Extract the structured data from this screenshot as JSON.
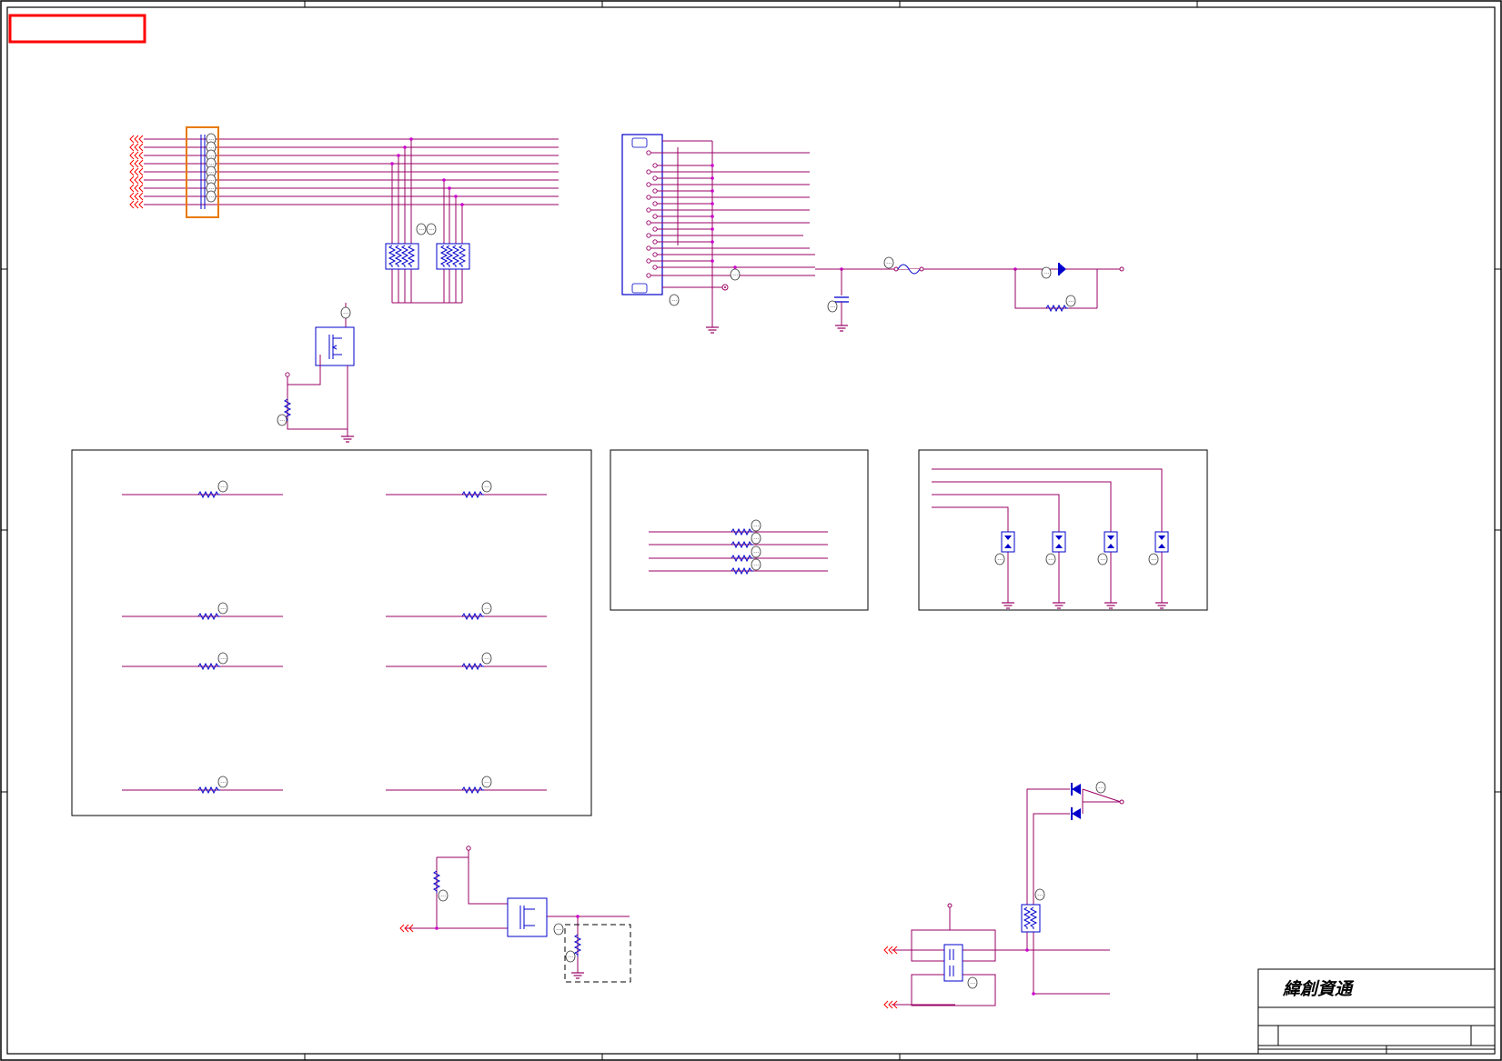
{
  "title_block": {
    "company": "緯創資通"
  },
  "colors": {
    "wire": "#990066",
    "component": "#0000cc",
    "sheet_border": "#000000",
    "highlight_box": "#ff0000",
    "connector_box": "#e87a00",
    "net_arrow": "#ff0000",
    "junction": "#cc00cc"
  },
  "icons": {
    "ground": "ground-symbol-icon",
    "resistor": "resistor-icon",
    "capacitor": "capacitor-icon",
    "diode": "diode-icon",
    "fuse": "fuse-icon",
    "mosfet": "mosfet-icon",
    "net_port": "net-port-arrow-icon"
  }
}
